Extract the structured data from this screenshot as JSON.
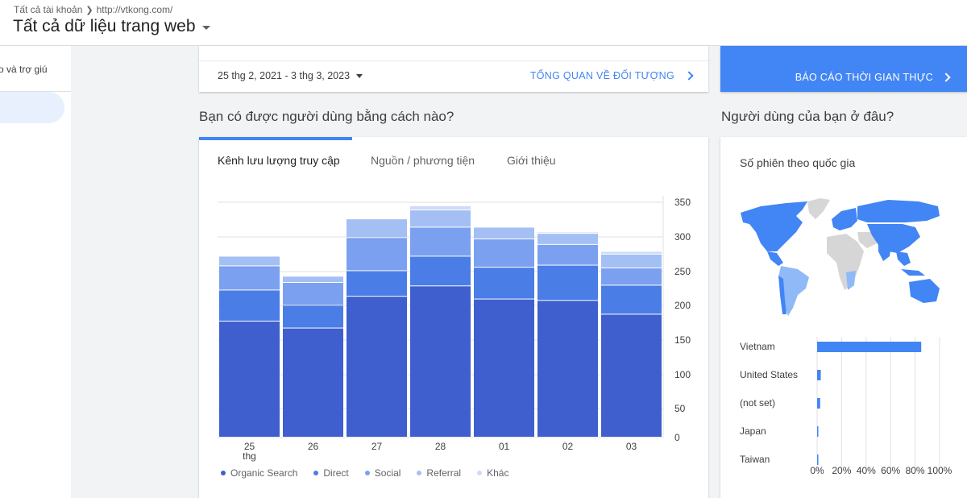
{
  "header": {
    "breadcrumb_account": "Tất cả tài khoản",
    "breadcrumb_property": "http://vtkong.com/",
    "view_title": "Tất cả dữ liệu trang web"
  },
  "sidebar": {
    "item_label": "o và trợ giú"
  },
  "date_card": {
    "date_range": "25 thg 2, 2021 - 3 thg 3, 2023",
    "audience_link": "TỔNG QUAN VỀ ĐỐI TƯỢNG"
  },
  "realtime": {
    "label": "BÁO CÁO THỜI GIAN THỰC"
  },
  "acquisition": {
    "heading": "Bạn có được người dùng bằng cách nào?",
    "tabs": [
      "Kênh lưu lượng truy cập",
      "Nguồn / phương tiện",
      "Giới thiệu"
    ]
  },
  "geo": {
    "heading": "Người dùng của bạn ở đâu?",
    "subtitle": "Số phiên theo quốc gia"
  },
  "colors": {
    "primary": "#4285f4",
    "organic": "#3f5fce",
    "direct": "#4a7de6",
    "social": "#7ba0f0",
    "referral": "#a4bff4",
    "other": "#cddbf8",
    "map_active": "#4285f4",
    "map_light": "#8fb9f7",
    "map_inactive": "#d6d6d6"
  },
  "chart_data": [
    {
      "type": "bar",
      "stacked": true,
      "categories": [
        "25 thg",
        "26",
        "27",
        "28",
        "01",
        "02",
        "03"
      ],
      "series": [
        {
          "name": "Organic Search",
          "values": [
            168,
            158,
            204,
            219,
            200,
            198,
            178
          ]
        },
        {
          "name": "Direct",
          "values": [
            45,
            33,
            37,
            43,
            46,
            51,
            42
          ]
        },
        {
          "name": "Social",
          "values": [
            35,
            33,
            48,
            42,
            41,
            30,
            25
          ]
        },
        {
          "name": "Referral",
          "values": [
            14,
            9,
            27,
            25,
            17,
            16,
            20
          ]
        },
        {
          "name": "Khác",
          "values": [
            0,
            0,
            0,
            6,
            0,
            2,
            4
          ]
        }
      ],
      "yticks": [
        0,
        50,
        100,
        150,
        200,
        250,
        300,
        350
      ],
      "ylim": [
        0,
        350
      ],
      "legend": "bottom",
      "grid": true
    },
    {
      "type": "bar",
      "orientation": "horizontal",
      "title": "Số phiên theo quốc gia",
      "categories": [
        "Vietnam",
        "United States",
        "(not set)",
        "Japan",
        "Taiwan"
      ],
      "values": [
        85,
        3,
        2.5,
        0.5,
        0.5
      ],
      "xticks": [
        "0%",
        "20%",
        "40%",
        "60%",
        "80%",
        "100%"
      ],
      "xlim": [
        0,
        100
      ],
      "grid": true
    }
  ]
}
